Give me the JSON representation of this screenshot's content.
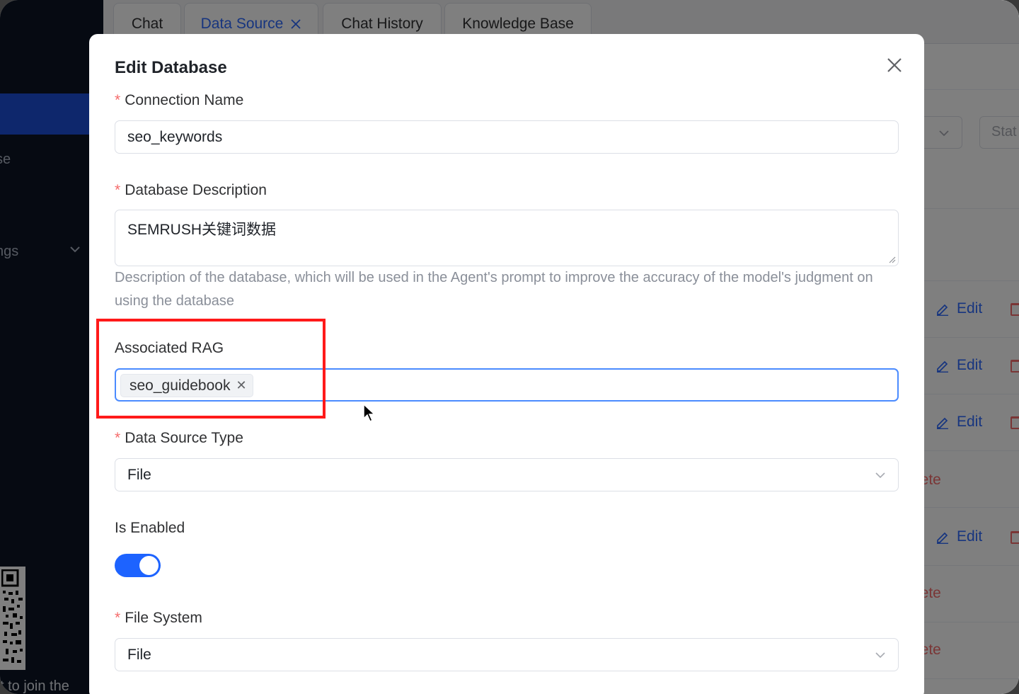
{
  "sidebar": {
    "partial_item_1": "se",
    "partial_item_2": "ngs",
    "footer_text": "t to join the"
  },
  "tabs": [
    {
      "label": "Chat"
    },
    {
      "label": "Data Source"
    },
    {
      "label": "Chat History"
    },
    {
      "label": "Knowledge Base"
    }
  ],
  "background": {
    "status_placeholder": "Stat",
    "edit_label": "Edit",
    "delete_label": "lete"
  },
  "modal": {
    "title": "Edit Database",
    "connection_name": {
      "label": "Connection Name",
      "value": "seo_keywords"
    },
    "description": {
      "label": "Database Description",
      "value": "SEMRUSH关键词数据",
      "help": "Description of the database, which will be used in the Agent's prompt to improve the accuracy of the model's judgment on using the database"
    },
    "associated_rag": {
      "label": "Associated RAG",
      "tags": [
        "seo_guidebook"
      ]
    },
    "data_source_type": {
      "label": "Data Source Type",
      "value": "File"
    },
    "is_enabled": {
      "label": "Is Enabled",
      "value": true
    },
    "file_system": {
      "label": "File System",
      "value": "File"
    }
  },
  "colors": {
    "accent": "#1d63ff",
    "required": "#f56c6c",
    "highlight": "#ff1a1a"
  }
}
